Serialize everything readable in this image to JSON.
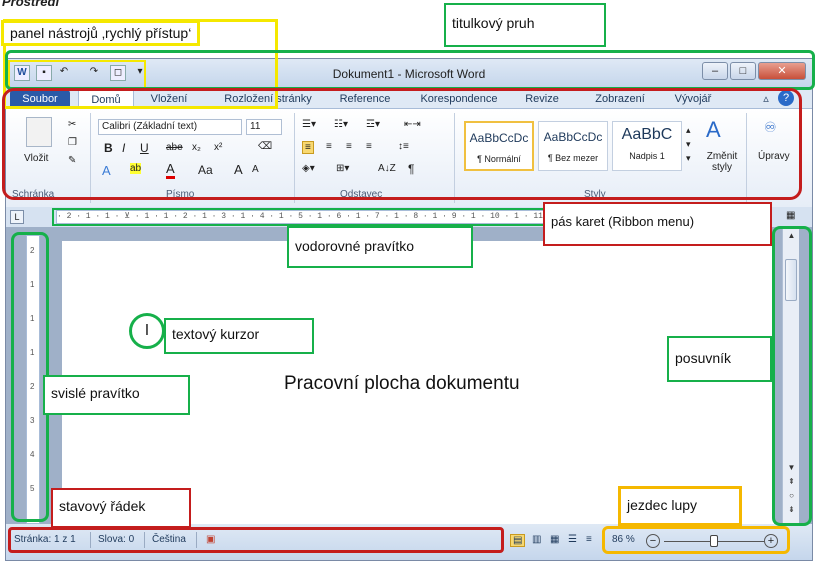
{
  "heading": "Prostředí",
  "window": {
    "title": "Dokument1 - Microsoft Word",
    "quick_access_icons": [
      "word-icon",
      "save-icon",
      "undo-icon",
      "redo-icon",
      "print-preview-icon",
      "dropdown-icon"
    ],
    "controls": {
      "minimize": "–",
      "maximize": "□",
      "close": "✕"
    }
  },
  "tabs": [
    "Soubor",
    "Domů",
    "Vložení",
    "Rozložení stránky",
    "Reference",
    "Korespondence",
    "Revize",
    "Zobrazení",
    "Vývojář"
  ],
  "ribbon": {
    "clipboard": {
      "paste": "Vložit",
      "group": "Schránka"
    },
    "font": {
      "name": "Calibri (Základní text)",
      "size": "11",
      "bold": "B",
      "italic": "I",
      "underline": "U",
      "strike": "abe",
      "sub": "x₂",
      "sup": "x²",
      "case": "Aa",
      "grow": "A",
      "shrink": "A",
      "group": "Písmo"
    },
    "paragraph": {
      "sort": "A↓Z",
      "pilcrow": "¶",
      "group": "Odstavec"
    },
    "styles": {
      "items": [
        {
          "sample": "AaBbCcDc",
          "name": "¶ Normální"
        },
        {
          "sample": "AaBbCcDc",
          "name": "¶ Bez mezer"
        },
        {
          "sample": "AaBbC",
          "name": "Nadpis 1"
        }
      ],
      "change": "Změnit styly",
      "group": "Styly"
    },
    "editing": {
      "label": "Úpravy"
    }
  },
  "ruler_text": "· 2 · 1 · 1 · ⊻ · 1 · 1 · 2 · 1 · 3 · 1 · 4 · 1 · 5 · 1 · 6 · 1 · 7 · 1 · 8 · 1 · 9 · 1 · 10 · 1 · 11 · 1",
  "status": {
    "page": "Stránka: 1 z 1",
    "words": "Slova: 0",
    "language": "Čeština",
    "zoom": "86 %",
    "zoom_level": 0.5
  },
  "document": {
    "cursor": "I",
    "workspace": "Pracovní plocha dokumentu"
  },
  "annotations": {
    "quick_access": "panel nástrojů ‚rychlý přístup‘",
    "title_bar": "titulkový pruh",
    "ribbon": "pás karet (Ribbon menu)",
    "h_ruler": "vodorovné pravítko",
    "cursor": "textový kurzor",
    "scrollbar": "posuvník",
    "v_ruler": "svislé pravítko",
    "status_bar": "stavový řádek",
    "zoom": "jezdec lupy"
  }
}
